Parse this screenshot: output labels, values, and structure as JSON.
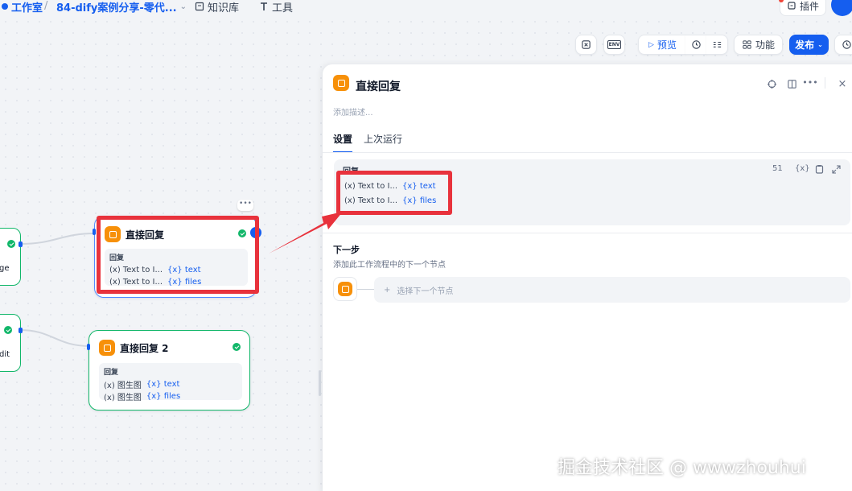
{
  "topnav": {
    "studio": "工作室",
    "app_name": "84-dify案例分享-零代...",
    "knowledge": "知识库",
    "tools": "工具",
    "plugins": "插件"
  },
  "toolbar": {
    "preview": "预览",
    "features": "功能",
    "publish": "发布",
    "env_label": "ENV"
  },
  "canvas": {
    "left_node_1_text": "ge",
    "left_node_2_text": "dit",
    "node1": {
      "title": "直接回复",
      "reply_label": "回复",
      "rows": [
        {
          "src": "(x) Text to I...",
          "ref": "{x} text"
        },
        {
          "src": "(x) Text to I...",
          "ref": "{x} files"
        }
      ]
    },
    "node2": {
      "title": "直接回复 2",
      "reply_label": "回复",
      "rows": [
        {
          "src": "(x) 图生图",
          "ref": "{x} text"
        },
        {
          "src": "(x) 图生图",
          "ref": "{x} files"
        }
      ]
    }
  },
  "panel": {
    "title": "直接回复",
    "description_placeholder": "添加描述...",
    "tabs": [
      "设置",
      "上次运行"
    ],
    "reply_label": "回复",
    "char_count": "51",
    "var_btn": "{x}",
    "rows": [
      {
        "src": "(x) Text to I...",
        "ref": "{x} text"
      },
      {
        "src": "(x) Text to I...",
        "ref": "{x} files"
      }
    ],
    "next_step_title": "下一步",
    "next_step_desc": "添加此工作流程中的下一个节点",
    "select_next": "选择下一个节点"
  },
  "watermark": "掘金技术社区 @ wwwzhouhui",
  "colors": {
    "accent": "#155eef",
    "node_icon": "#f79009",
    "success": "#12b76a",
    "highlight": "#e8323c"
  }
}
